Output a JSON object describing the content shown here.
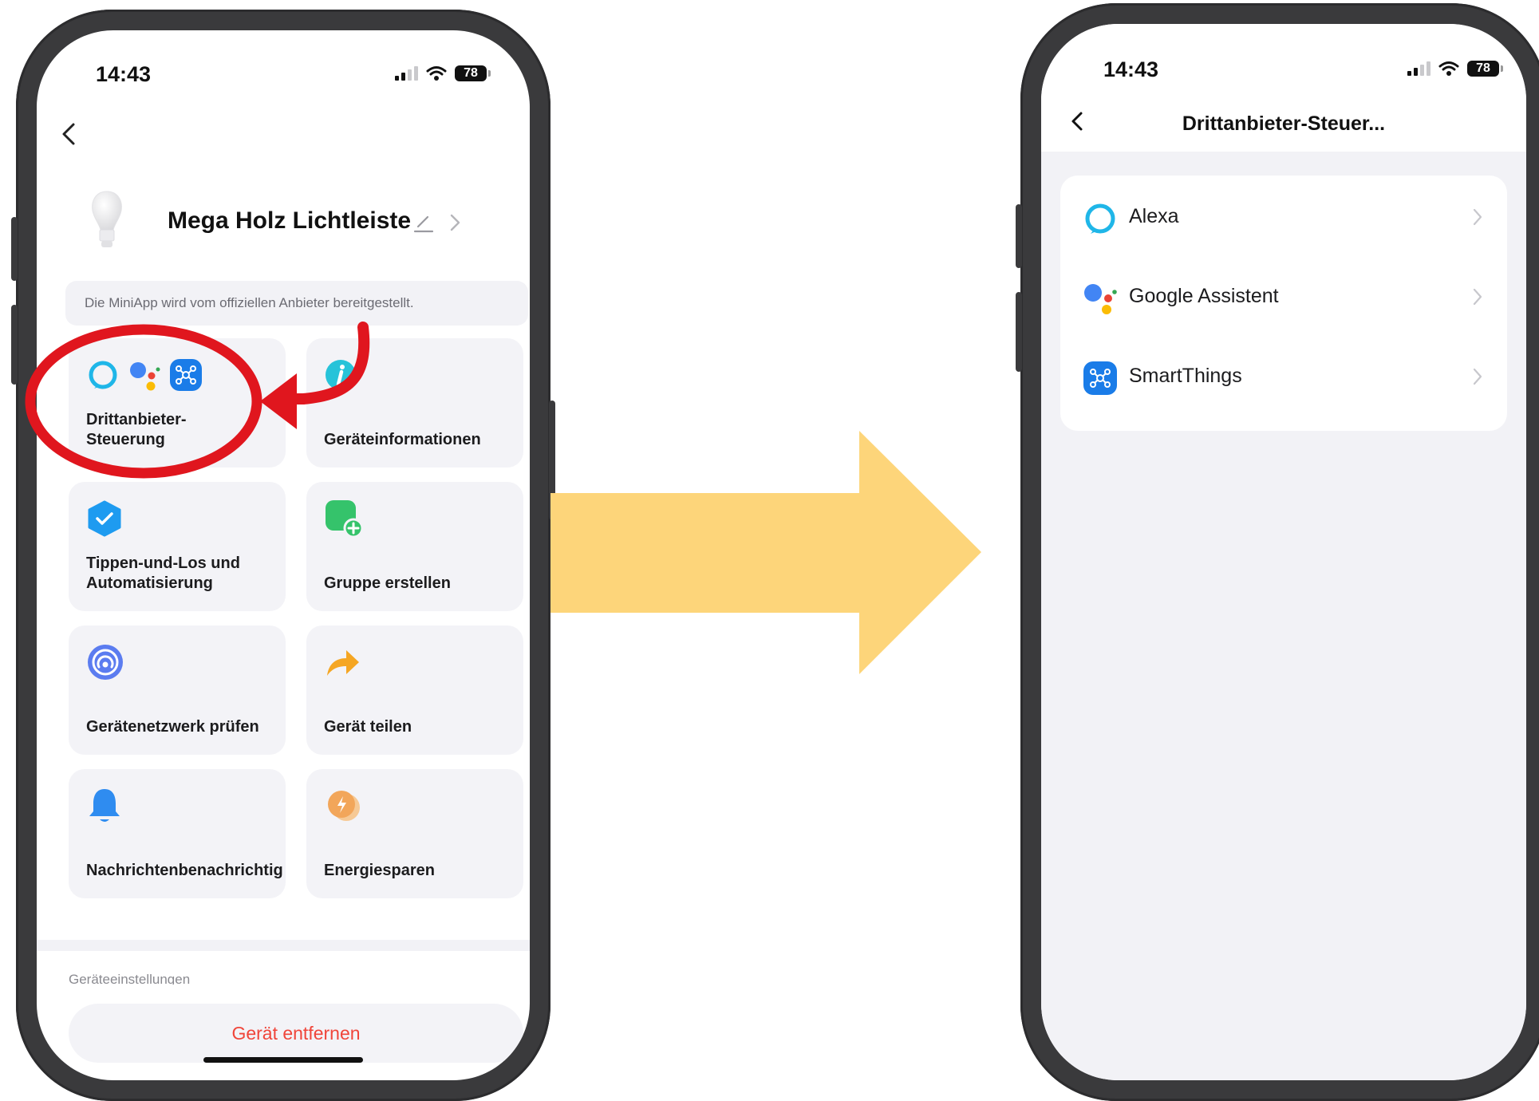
{
  "left_screen": {
    "status": {
      "time": "14:43",
      "battery": "78"
    },
    "device_name": "Mega Holz Lichtleiste",
    "notice": "Die MiniApp wird vom offiziellen Anbieter bereitgestellt.",
    "tiles": [
      {
        "label": "Drittanbieter-\nSteuerung",
        "icon": "third-party-icons"
      },
      {
        "label": "Geräteinformationen",
        "icon": "info-icon"
      },
      {
        "label": "Tippen-und-Los und\nAutomatisierung",
        "icon": "shield-check-icon"
      },
      {
        "label": "Gruppe erstellen",
        "icon": "group-add-icon"
      },
      {
        "label": "Gerätenetzwerk prüfen",
        "icon": "network-icon"
      },
      {
        "label": "Gerät teilen",
        "icon": "share-icon"
      },
      {
        "label": "Nachrichtenbenachrichtig",
        "icon": "bell-icon"
      },
      {
        "label": "Energiesparen",
        "icon": "energy-icon"
      }
    ],
    "section_label": "Geräteeinstellungen",
    "remove_button": "Gerät entfernen"
  },
  "right_screen": {
    "status": {
      "time": "14:43",
      "battery": "78"
    },
    "title": "Drittanbieter-Steuer...",
    "items": [
      {
        "label": "Alexa",
        "icon": "alexa-icon"
      },
      {
        "label": "Google Assistent",
        "icon": "google-assistant-icon"
      },
      {
        "label": "SmartThings",
        "icon": "smartthings-icon"
      }
    ]
  },
  "colors": {
    "annotation_red": "#e0161e",
    "arrow_yellow": "#fdd57a",
    "danger_text": "#f0453a",
    "alexa_cyan": "#1fb6e8",
    "smartthings_blue": "#1a7ce8"
  }
}
